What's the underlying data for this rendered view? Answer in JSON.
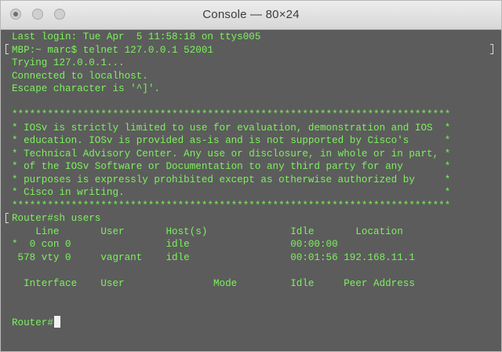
{
  "window": {
    "title": "Console — 80×24"
  },
  "terminal": {
    "lines": [
      "Last login: Tue Apr  5 11:58:18 on ttys005",
      "MBP:~ marc$ telnet 127.0.0.1 52001",
      "Trying 127.0.0.1...",
      "Connected to localhost.",
      "Escape character is '^]'.",
      "",
      "**************************************************************************",
      "* IOSv is strictly limited to use for evaluation, demonstration and IOS  *",
      "* education. IOSv is provided as-is and is not supported by Cisco's      *",
      "* Technical Advisory Center. Any use or disclosure, in whole or in part, *",
      "* of the IOSv Software or Documentation to any third party for any       *",
      "* purposes is expressly prohibited except as otherwise authorized by     *",
      "* Cisco in writing.                                                      *",
      "**************************************************************************",
      "Router#sh users",
      "    Line       User       Host(s)              Idle       Location",
      "*  0 con 0                idle                 00:00:00",
      " 578 vty 0     vagrant    idle                 00:01:56 192.168.11.1",
      "",
      "  Interface    User               Mode         Idle     Peer Address",
      "",
      ""
    ],
    "prompt": "Router#"
  },
  "colors": {
    "terminal_background": "#5c5c5c",
    "terminal_text": "#7cf25c",
    "cursor": "#f2f2f2",
    "titlebar": "#e2e2e2"
  }
}
